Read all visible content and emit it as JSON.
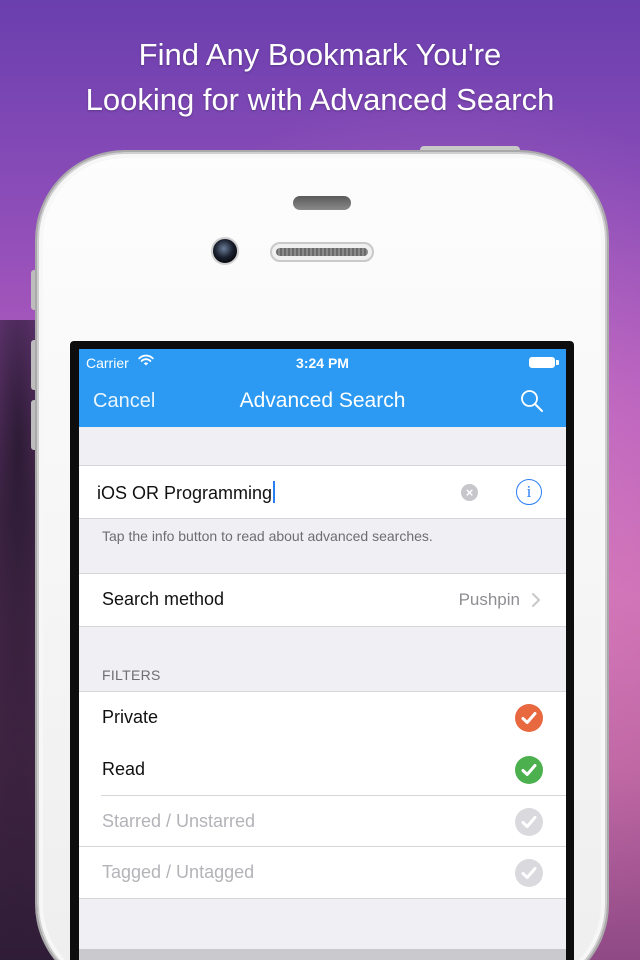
{
  "promo": {
    "headline": "Find Any Bookmark You're\nLooking for with Advanced Search"
  },
  "status_bar": {
    "carrier": "Carrier",
    "time": "3:24 PM"
  },
  "nav_bar": {
    "cancel_label": "Cancel",
    "title": "Advanced Search",
    "search_icon": "search-icon"
  },
  "search": {
    "value": "iOS OR Programming",
    "clear_icon": "clear-icon",
    "info_icon": "info-icon",
    "footnote": "Tap the info button to read about advanced searches."
  },
  "method": {
    "label": "Search method",
    "value": "Pushpin"
  },
  "filters": {
    "header": "FILTERS",
    "items": [
      {
        "label": "Private",
        "state": "on",
        "color": "#e8683f"
      },
      {
        "label": "Read",
        "state": "on",
        "color": "#4cb04f"
      },
      {
        "label": "Starred / Unstarred",
        "state": "off",
        "color": "#d9d9de"
      },
      {
        "label": "Tagged / Untagged",
        "state": "off",
        "color": "#d9d9de"
      }
    ]
  },
  "colors": {
    "nav_blue": "#2c9af2",
    "tint": "#2c7ff0",
    "grouped_bg": "#efeff4"
  }
}
